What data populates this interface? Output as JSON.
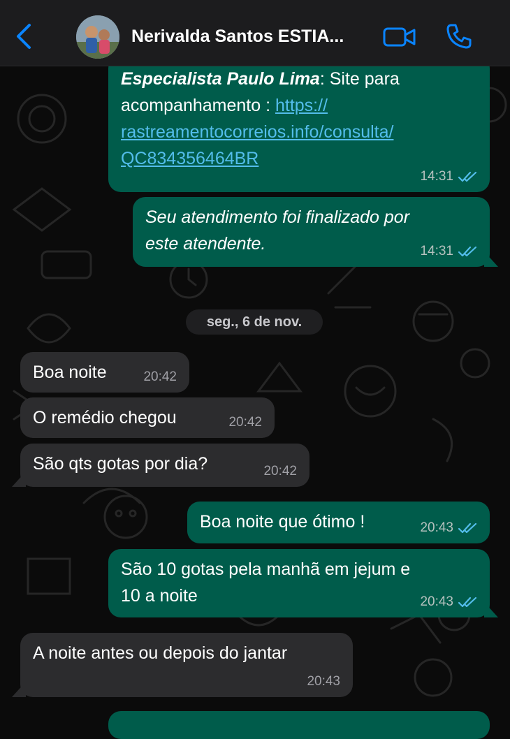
{
  "header": {
    "contact_name": "Nerivalda Santos ESTIA..."
  },
  "colors": {
    "outgoing_bubble": "#005c4b",
    "incoming_bubble": "#2c2c2e",
    "link": "#53bdeb",
    "read_ticks": "#53bdeb",
    "accent": "#0a84ff"
  },
  "icons": {
    "back": "chevron-left-icon",
    "video": "video-camera-icon",
    "call": "phone-icon",
    "read": "double-check-icon"
  },
  "messages": [
    {
      "direction": "outgoing",
      "sender_label": "Especialista Paulo Lima",
      "text_after_sender": ": Site para",
      "line2": "acompanhamento  : ",
      "link_lines": [
        "https://",
        "rastreamentocorreios.info/consulta/",
        "QC834356464BR"
      ],
      "time": "14:31",
      "status": "read"
    },
    {
      "direction": "outgoing",
      "lines": [
        "Seu atendimento foi finalizado por",
        "este atendente."
      ],
      "time": "14:31",
      "status": "read"
    },
    {
      "direction": "incoming",
      "lines": [
        "Boa noite"
      ],
      "time": "20:42"
    },
    {
      "direction": "incoming",
      "lines": [
        "O remédio chegou"
      ],
      "time": "20:42"
    },
    {
      "direction": "incoming",
      "lines": [
        "São qts gotas por dia?"
      ],
      "time": "20:42"
    },
    {
      "direction": "outgoing",
      "lines": [
        "Boa noite que ótimo !"
      ],
      "time": "20:43",
      "status": "read"
    },
    {
      "direction": "outgoing",
      "lines": [
        "São 10 gotas pela manhã em jejum e",
        "10 a noite"
      ],
      "time": "20:43",
      "status": "read"
    },
    {
      "direction": "incoming",
      "lines": [
        "A noite antes ou depois do jantar"
      ],
      "time": "20:43"
    }
  ],
  "date_divider": "seg., 6 de nov."
}
